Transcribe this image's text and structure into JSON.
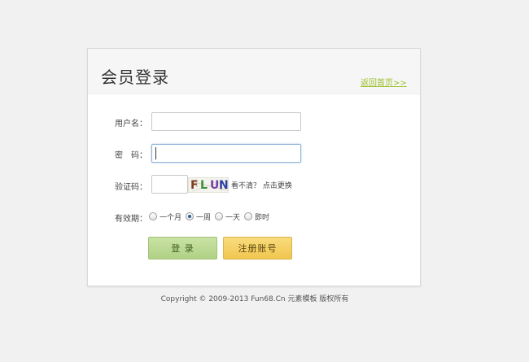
{
  "panel": {
    "title": "会员登录",
    "home_link": "返回首页>>"
  },
  "form": {
    "username": {
      "label": "用户名：",
      "value": "",
      "placeholder": ""
    },
    "password": {
      "label": "密　码：",
      "value": "",
      "placeholder": ""
    },
    "captcha": {
      "label": "验证码：",
      "value": "",
      "image_text": [
        "F",
        "L",
        "U",
        "N"
      ],
      "image_colors": [
        "#7a3e1e",
        "#3b8f3b",
        "#7a3fa8",
        "#2b3fa0"
      ],
      "unclear_text": "看不清？",
      "refresh_label": "点击更换"
    },
    "validity": {
      "label": "有效期：",
      "options": [
        {
          "label": "一个月",
          "checked": false
        },
        {
          "label": "一周",
          "checked": true
        },
        {
          "label": "一天",
          "checked": false
        },
        {
          "label": "即时",
          "checked": false
        }
      ]
    },
    "login_button": "登 录",
    "register_button": "注册账号"
  },
  "footer": {
    "copyright": "Copyright © 2009-2013 Fun68.Cn 元素模板 版权所有"
  },
  "colors": {
    "accent_link": "#9bbf2b",
    "login_button": "#b9d88f",
    "register_button": "#f3cd5e"
  }
}
